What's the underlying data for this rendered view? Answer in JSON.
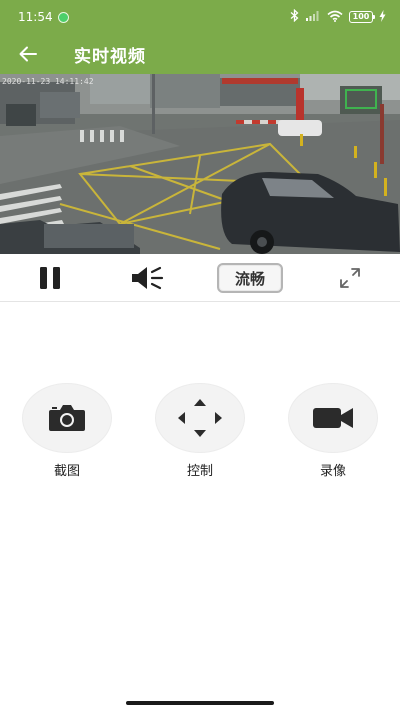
{
  "status_bar": {
    "time": "11:54",
    "battery": "100"
  },
  "header": {
    "title": "实时视频"
  },
  "video": {
    "timestamp": "2020-11-23 14:11:42"
  },
  "controls": {
    "quality_label": "流畅"
  },
  "actions": [
    {
      "label": "截图",
      "icon": "camera-icon"
    },
    {
      "label": "控制",
      "icon": "direction-pad-icon"
    },
    {
      "label": "录像",
      "icon": "video-camera-icon"
    }
  ],
  "colors": {
    "header_green": "#7cab4a",
    "circle_bg": "#f3f3f3",
    "icon_dark": "#2b2b2b"
  }
}
